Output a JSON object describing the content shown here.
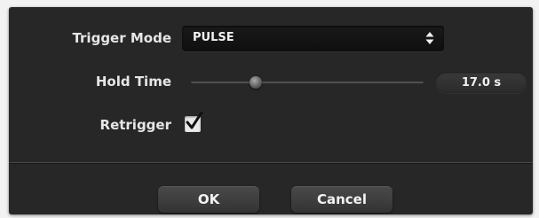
{
  "dialog": {
    "trigger_mode": {
      "label": "Trigger Mode",
      "value": "PULSE",
      "icon": "updown-chevron-icon"
    },
    "hold_time": {
      "label": "Hold Time",
      "value_text": "17.0 s",
      "slider_fraction": 0.28
    },
    "retrigger": {
      "label": "Retrigger",
      "checked": true,
      "icon": "checkmark-icon"
    },
    "buttons": {
      "ok_label": "OK",
      "cancel_label": "Cancel"
    }
  },
  "colors": {
    "dialog_bg": "#272727",
    "text": "#e6e6e6"
  }
}
